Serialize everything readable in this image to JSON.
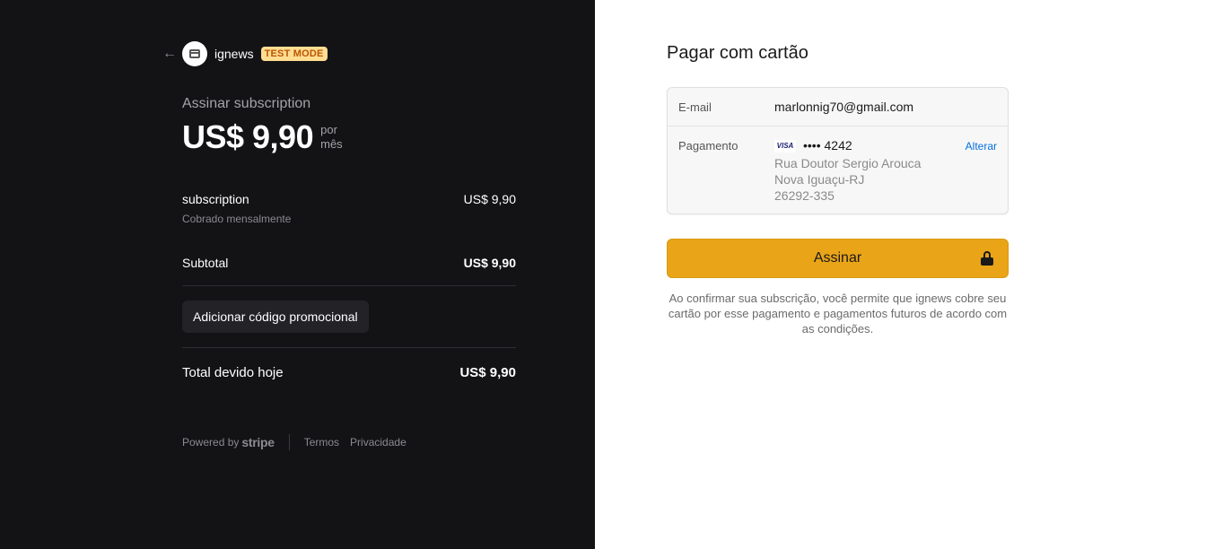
{
  "header": {
    "brand": "ignews",
    "badge": "TEST MODE"
  },
  "summary": {
    "title": "Assinar subscription",
    "price": "US$ 9,90",
    "per_line1": "por",
    "per_line2": "mês"
  },
  "line_item": {
    "name": "subscription",
    "price": "US$ 9,90",
    "note": "Cobrado mensalmente"
  },
  "subtotal": {
    "label": "Subtotal",
    "value": "US$ 9,90"
  },
  "promo_button_label": "Adicionar código promocional",
  "total": {
    "label": "Total devido hoje",
    "value": "US$ 9,90"
  },
  "footer": {
    "powered_by": "Powered by",
    "stripe": "stripe",
    "terms": "Termos",
    "privacy": "Privacidade"
  },
  "payment": {
    "title": "Pagar com cartão",
    "email_label": "E-mail",
    "email_value": "marlonnig70@gmail.com",
    "payment_label": "Pagamento",
    "card_brand": "VISA",
    "card_number": "•••• 4242",
    "change_link": "Alterar",
    "address_line1": "Rua Doutor Sergio Arouca",
    "address_line2": "Nova Iguaçu-RJ",
    "address_line3": "26292-335",
    "submit_label": "Assinar",
    "terms_text": "Ao confirmar sua subscrição, você permite que ignews cobre seu cartão por esse pagamento e pagamentos futuros de acordo com as condições."
  },
  "colors": {
    "left_background": "#131316",
    "submit_button": "#e9a418",
    "badge_background": "#ffde92",
    "link": "#0570de"
  },
  "icons": {
    "back": "arrow-left-icon",
    "store": "store-icon",
    "lock": "lock-icon"
  }
}
